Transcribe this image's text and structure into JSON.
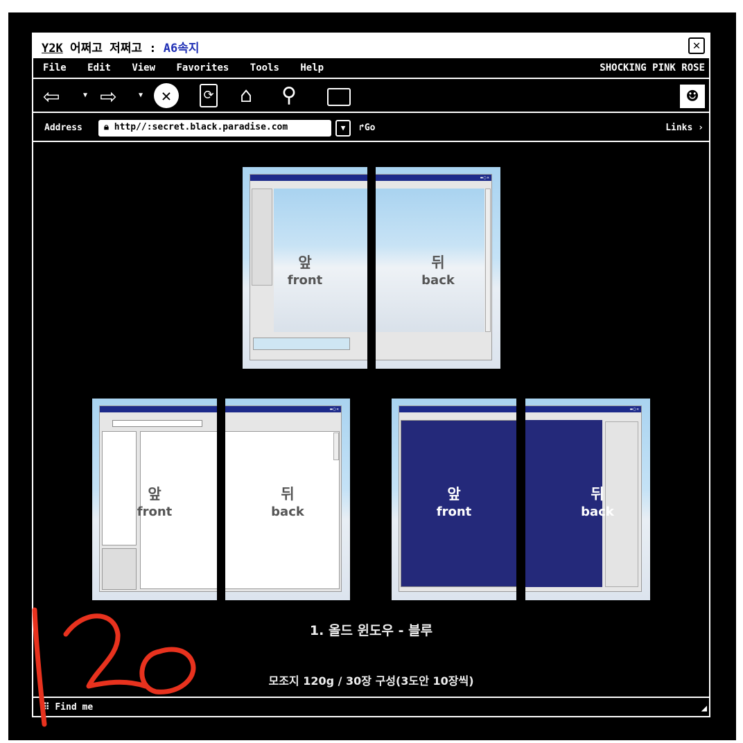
{
  "window": {
    "title_prefix": "Y2K",
    "title_main": " 어쩌고 저쩌고 : ",
    "title_accent": "A6속지",
    "close_icon": "close-icon"
  },
  "menu": {
    "items": [
      "File",
      "Edit",
      "View",
      "Favorites",
      "Tools",
      "Help"
    ],
    "right": "SHOCKING PINK ROSE"
  },
  "toolbar": {
    "icons": [
      "back-arrow-icon",
      "forward-arrow-icon",
      "stop-icon",
      "refresh-icon",
      "home-icon",
      "search-icon",
      "folder-icon",
      "smiley-icon"
    ]
  },
  "address": {
    "label": "Address",
    "value": "http//:secret.black.paradise.com",
    "go": "Go",
    "links": "Links"
  },
  "cards": {
    "front_ko": "앞",
    "front_en": "front",
    "back_ko": "뒤",
    "back_en": "back"
  },
  "captions": {
    "title": "1. 올드 윈도우 - 블루",
    "spec": "모조지 120g / 30장 구성(3도안 10장씩)"
  },
  "status": {
    "text": "Find me"
  },
  "overlay": {
    "handwriting": "120",
    "color": "#e8321e"
  },
  "colors": {
    "window_titlebar": "#1c2a8a",
    "navy": "#24297a",
    "accent": "#1f2fb5"
  }
}
